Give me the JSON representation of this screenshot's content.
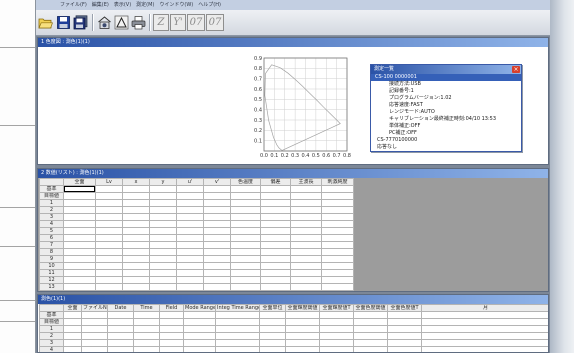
{
  "app": {
    "menu": [
      "ファイル(F)",
      "編集(E)",
      "表示(V)",
      "測定(M)",
      "ウインドウ(W)",
      "ヘルプ(H)"
    ],
    "toolbar": {
      "icons": [
        "open-folder-icon",
        "save-icon",
        "save-all-icon",
        "measure-icon",
        "chart-icon",
        "print-icon"
      ],
      "buttons": [
        "Z",
        "Y'",
        "07",
        "07"
      ]
    }
  },
  "chromaticity_window": {
    "title": "1 色度図 : 測色(1)(1)"
  },
  "measure_list": {
    "title": "測定一覧",
    "close_label": "×",
    "lines": [
      "CS-100 0000001",
      "接続方法:USB",
      "記録番号:1",
      "プログラムバージョン:1.02",
      "応答速度:FAST",
      "レンジモード:AUTO",
      "キャリブレーション最終補正時刻:04/10 13:53",
      "単体補正:OFF",
      "PC補正:OFF",
      "CS-7770100000",
      "応答なし"
    ]
  },
  "value_window": {
    "title": "2 数値(リスト) : 測色(1)(1)",
    "columns": [
      "全面",
      "Lv",
      "x",
      "y",
      "u'",
      "v'",
      "色温度",
      "偏差",
      "主波長",
      "刺激純度"
    ],
    "row_labels": [
      "基準",
      "目標値",
      "1",
      "2",
      "3",
      "4",
      "5",
      "6",
      "7",
      "8",
      "9",
      "10",
      "11",
      "12",
      "13"
    ]
  },
  "log_window": {
    "title": "測色(1)(1)",
    "columns": [
      "全面",
      "ファイルNo",
      "Date",
      "Time",
      "Field",
      "Mode Range",
      "Integ Time Range",
      "全面単位",
      "全面輝度閾値",
      "全面輝度値T",
      "全面色度閾値",
      "全面色度値T",
      "月"
    ],
    "row_labels": [
      "基準",
      "目標値",
      "1",
      "2",
      "3",
      "4"
    ]
  },
  "colors": {
    "titlebar_start": "#2a52a6",
    "titlebar_end": "#8fb3e8",
    "selection": "#3560b8",
    "close_button": "#d8402c",
    "empty_area": "#9c9c9c"
  },
  "chart_data": {
    "type": "line",
    "xlim": [
      0,
      0.8
    ],
    "ylim": [
      0,
      0.9
    ],
    "grid": true,
    "xticks": [
      "0.0",
      "0.1",
      "0.2",
      "0.3",
      "0.4",
      "0.5",
      "0.6",
      "0.7",
      "0.8"
    ],
    "yticks": [
      "0.1",
      "0.2",
      "0.3",
      "0.4",
      "0.5",
      "0.6",
      "0.7",
      "0.8",
      "0.9"
    ],
    "series": [
      {
        "x": [
          0.174,
          0.144,
          0.124,
          0.091,
          0.045,
          0.008,
          0.014,
          0.074,
          0.155,
          0.23,
          0.302,
          0.373,
          0.444,
          0.513,
          0.575,
          0.627,
          0.692,
          0.735
        ],
        "y": [
          0.005,
          0.03,
          0.058,
          0.133,
          0.295,
          0.538,
          0.75,
          0.834,
          0.806,
          0.754,
          0.692,
          0.625,
          0.555,
          0.487,
          0.424,
          0.373,
          0.308,
          0.265
        ],
        "closed": true
      }
    ]
  }
}
